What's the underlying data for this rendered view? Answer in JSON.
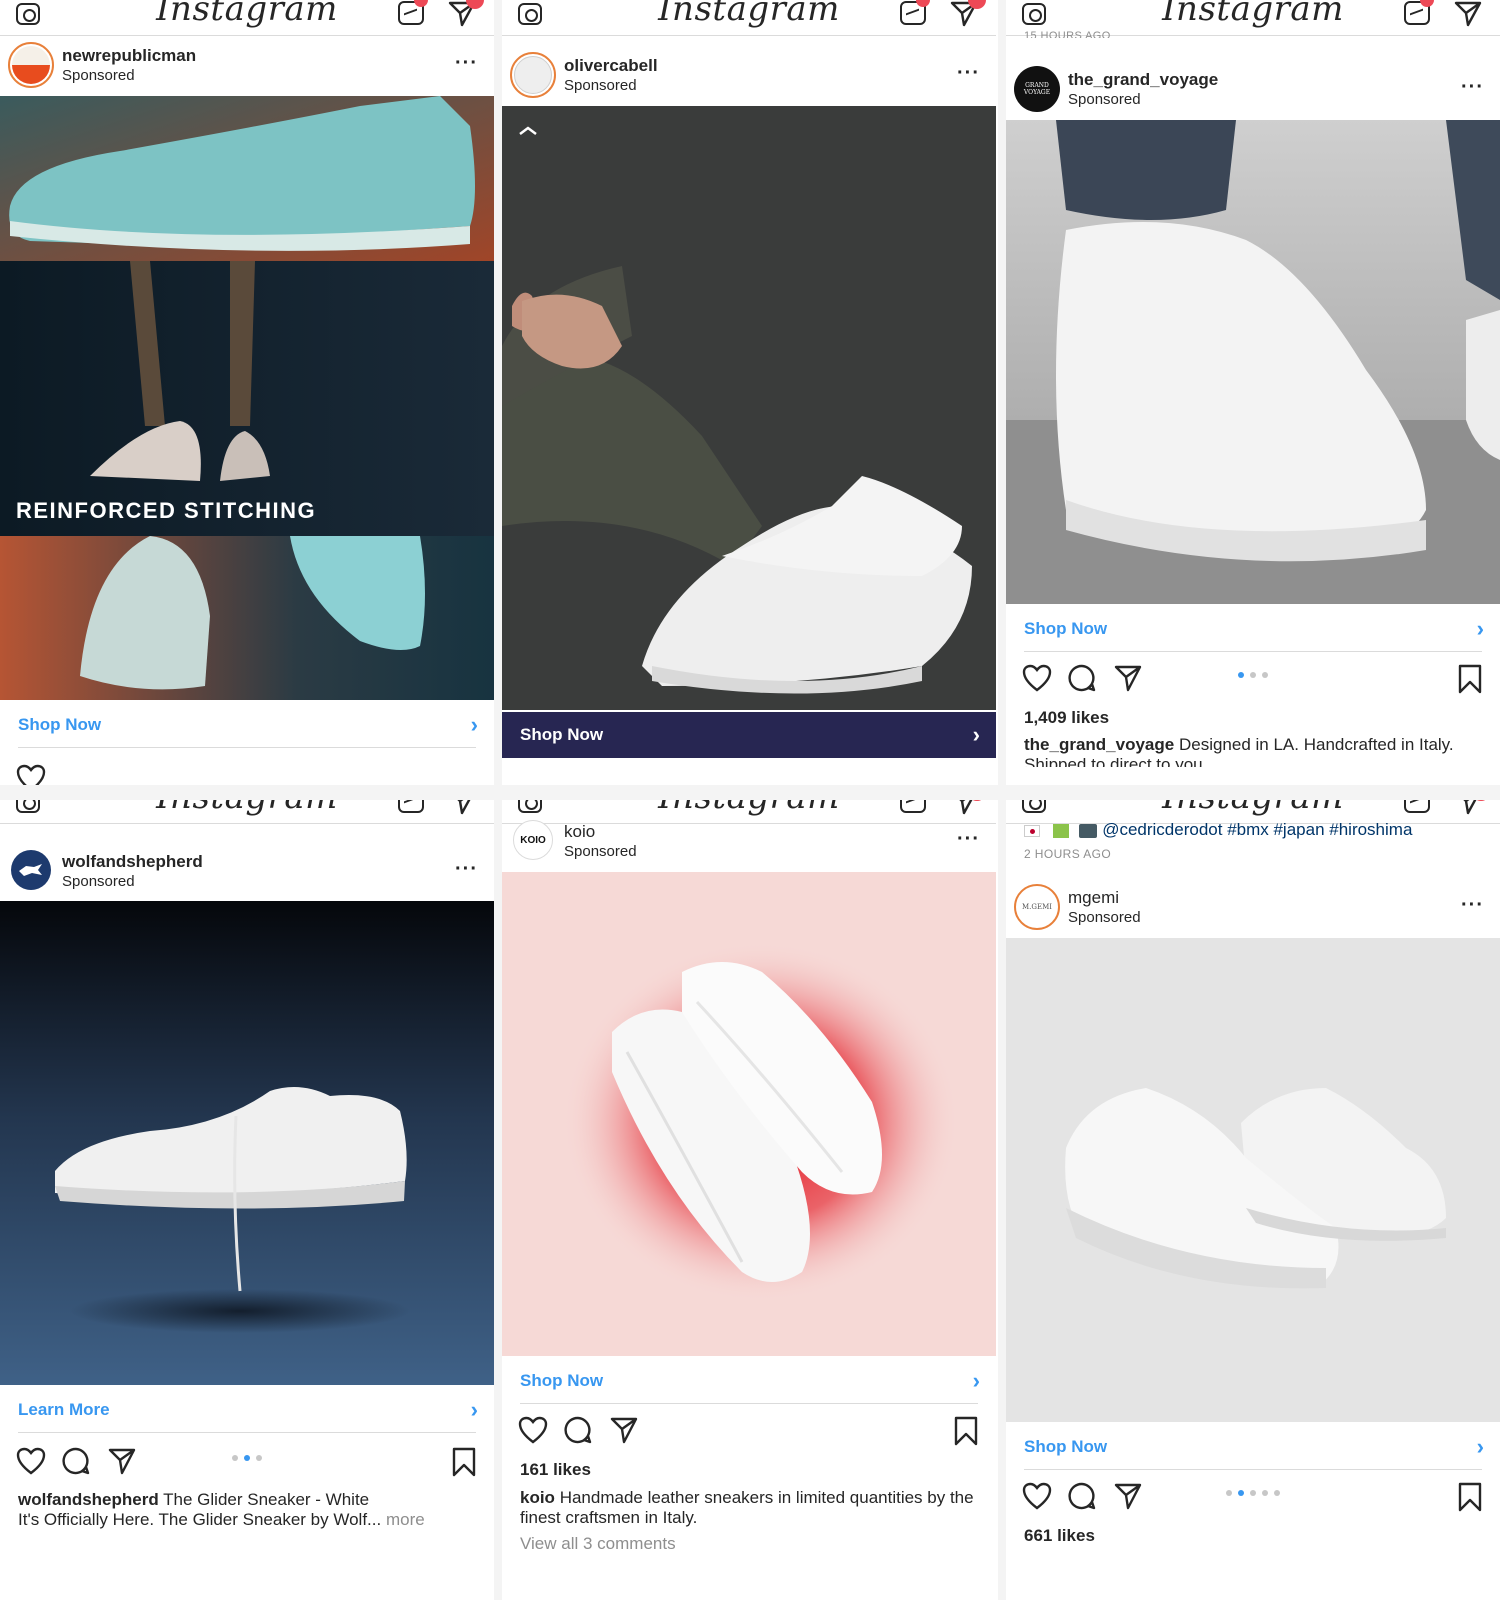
{
  "app": {
    "logo": "Instagram"
  },
  "posts": [
    {
      "username": "newrepublicman",
      "sponsored": "Sponsored",
      "overlay_text": "REINFORCED STITCHING",
      "cta": "Shop Now",
      "avatar_colors": [
        "#e84c1e",
        "#f5f0e8"
      ]
    },
    {
      "username": "olivercabell",
      "sponsored": "Sponsored",
      "cta": "Shop Now"
    },
    {
      "username": "the_grand_voyage",
      "sponsored": "Sponsored",
      "header_fragment": "15 HOURS AGO",
      "cta": "Shop Now",
      "likes": "1,409 likes",
      "caption_user": "the_grand_voyage",
      "caption_text": "Designed in LA. Handcrafted in Italy. Shipped to direct to you.",
      "avatar_text": "GRAND VOYAGE",
      "carousel": {
        "count": 3,
        "active": 1
      }
    },
    {
      "username": "wolfandshepherd",
      "sponsored": "Sponsored",
      "cta": "Learn More",
      "caption_user": "wolfandshepherd",
      "caption_text": "The Glider Sneaker - White",
      "caption_line2": "It's Officially Here. The Glider Sneaker by Wolf...",
      "caption_more": "more",
      "carousel": {
        "count": 3,
        "active": 2
      }
    },
    {
      "username": "koio",
      "sponsored": "Sponsored",
      "avatar_text": "KOIO",
      "cta": "Shop Now",
      "likes": "161 likes",
      "caption_user": "koio",
      "caption_text": "Handmade leather sneakers in limited quantities by the finest craftsmen in Italy.",
      "view_comments": "View all 3 comments"
    },
    {
      "username": "mgemi",
      "sponsored": "Sponsored",
      "avatar_text": "M.GEMI",
      "prev_caption_tags": "@cedricderodot #bmx #japan #hiroshima",
      "prev_time": "2 HOURS AGO",
      "cta": "Shop Now",
      "likes": "661 likes",
      "carousel": {
        "count": 5,
        "active": 2
      }
    }
  ],
  "colors": {
    "link_blue": "#3897f0",
    "cta_dark": "#272652",
    "notification_red": "#ed4956"
  }
}
